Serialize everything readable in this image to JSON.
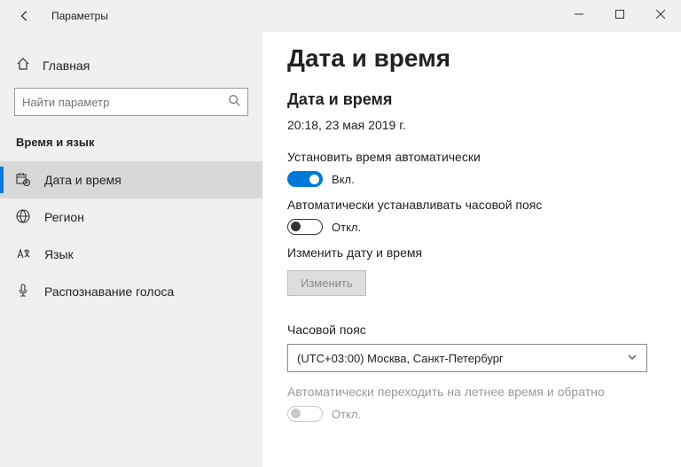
{
  "titlebar": {
    "title": "Параметры"
  },
  "sidebar": {
    "home": "Главная",
    "search_placeholder": "Найти параметр",
    "category": "Время и язык",
    "items": [
      {
        "label": "Дата и время"
      },
      {
        "label": "Регион"
      },
      {
        "label": "Язык"
      },
      {
        "label": "Распознавание голоса"
      }
    ]
  },
  "content": {
    "page_title": "Дата и время",
    "section_title": "Дата и время",
    "current_datetime": "20:18, 23 мая 2019 г.",
    "auto_time": {
      "label": "Установить время автоматически",
      "state": "Вкл."
    },
    "auto_tz": {
      "label": "Автоматически устанавливать часовой пояс",
      "state": "Откл."
    },
    "change_dt": {
      "label": "Изменить дату и время",
      "button": "Изменить"
    },
    "timezone": {
      "label": "Часовой пояс",
      "value": "(UTC+03:00) Москва, Санкт-Петербург"
    },
    "dst": {
      "label": "Автоматически переходить на летнее время и обратно",
      "state": "Откл."
    }
  }
}
